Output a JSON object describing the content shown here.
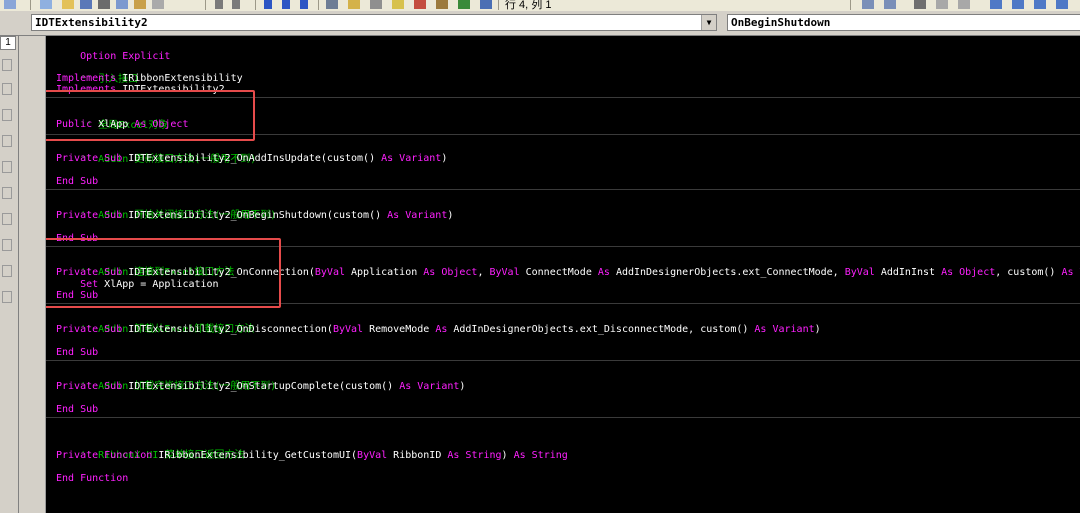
{
  "toolbar": {
    "partial_text": "行 4, 列 1"
  },
  "object_combo": {
    "value": "IDTExtensibility2"
  },
  "proc_combo": {
    "value": "OnBeginShutdown"
  },
  "left_panel": {
    "counter": "1"
  },
  "code": {
    "l01": {
      "a": "Option Explicit"
    },
    "l02": {
      "c": "'' 引入接口"
    },
    "l03": {
      "a": "Implements ",
      "b": "IRibbonExtensibility"
    },
    "l04": {
      "a": "Implements ",
      "b": "IDTExtensibility2"
    },
    "l05": {
      "c": "'' 全局Excel对象"
    },
    "l06": {
      "a": "Public ",
      "b": "XlApp ",
      "d": "As Object"
    },
    "l07": {
      "c": "'' Addin 更新接口方法(一般用不到)"
    },
    "l08": {
      "a": "Private Sub ",
      "b": "IDTExtensibility2_OnAddInsUpdate(custom() ",
      "d": "As Variant",
      "e": ")"
    },
    "l09": {
      "a": "End Sub"
    },
    "l10": {
      "c": "'' Addin 开始关闭接口方法(一般用不到)"
    },
    "l11": {
      "a": "Private Sub ",
      "b": "IDTExtensibility2_OnBeginShutdown(custom() ",
      "d": "As Variant",
      "e": ")"
    },
    "l12": {
      "a": "End Sub"
    },
    "l13": {
      "c": "'' Addin 连接到Excel接口方法"
    },
    "l14": {
      "a": "Private Sub ",
      "b": "IDTExtensibility2_OnConnection(",
      "k1": "ByVal ",
      "t1": "Application ",
      "k2": "As Object",
      "t2": ", ",
      "k3": "ByVal ",
      "t3": "ConnectMode ",
      "k4": "As ",
      "t4": "AddInDesignerObjects.ext_ConnectMode, ",
      "k5": "ByVal ",
      "t5": "AddInInst ",
      "k6": "As Object",
      "t6": ", custom() ",
      "k7": "As Variant",
      "t7": ")"
    },
    "l15": {
      "a": "    Set ",
      "b": "XlApp = Application"
    },
    "l16": {
      "a": "End Sub"
    },
    "l17": {
      "c": "'' Addin 卸载从Excel卸载接口方法"
    },
    "l18": {
      "a": "Private Sub ",
      "b": "IDTExtensibility2_OnDisconnection(",
      "k1": "ByVal ",
      "t1": "RemoveMode ",
      "k2": "As ",
      "t2": "AddInDesignerObjects.ext_DisconnectMode, custom() ",
      "k3": "As Variant",
      "t3": ")"
    },
    "l19": {
      "a": "End Sub"
    },
    "l20": {
      "c": "'' Addin 加载完毕接口方法(一般用不到)"
    },
    "l21": {
      "a": "Private Sub ",
      "b": "IDTExtensibility2_OnStartupComplete(custom() ",
      "d": "As Variant",
      "e": ")"
    },
    "l22": {
      "a": "End Sub"
    },
    "l23": {
      "c": "'' RibbonX UI 菜单接口返回方法"
    },
    "l24": {
      "a": "Private Function ",
      "b": "IRibbonExtensibility_GetCustomUI(",
      "k1": "ByVal ",
      "t1": "RibbonID ",
      "k2": "As String",
      "t2": ") ",
      "k3": "As String"
    },
    "l25": {
      "a": "End Function"
    }
  },
  "colors": {
    "keyword": "#ff21ff",
    "identifier": "#ffffff",
    "comment": "#00c000",
    "highlight": "#e64b4b",
    "background": "#000000"
  }
}
